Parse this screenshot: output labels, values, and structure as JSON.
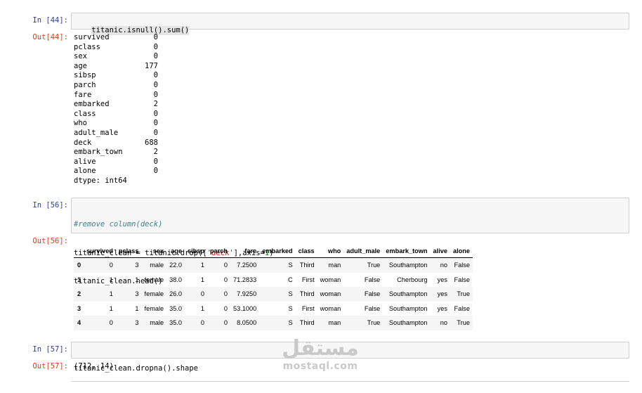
{
  "cells": [
    {
      "in_prompt": "In [44]:",
      "code": "titanic.isnull().sum()",
      "out_prompt": "Out[44]:",
      "series": [
        {
          "k": "survived",
          "v": "0"
        },
        {
          "k": "pclass",
          "v": "0"
        },
        {
          "k": "sex",
          "v": "0"
        },
        {
          "k": "age",
          "v": "177"
        },
        {
          "k": "sibsp",
          "v": "0"
        },
        {
          "k": "parch",
          "v": "0"
        },
        {
          "k": "fare",
          "v": "0"
        },
        {
          "k": "embarked",
          "v": "2"
        },
        {
          "k": "class",
          "v": "0"
        },
        {
          "k": "who",
          "v": "0"
        },
        {
          "k": "adult_male",
          "v": "0"
        },
        {
          "k": "deck",
          "v": "688"
        },
        {
          "k": "embark_town",
          "v": "2"
        },
        {
          "k": "alive",
          "v": "0"
        },
        {
          "k": "alone",
          "v": "0"
        }
      ],
      "dtype": "dtype: int64"
    },
    {
      "in_prompt": "In [56]:",
      "code_comment": "#remove column(deck)",
      "code_line2_a": "titanic_clean = titanic.drop([",
      "code_line2_str": "'deck'",
      "code_line2_b": "],axis=",
      "code_line2_num": "1",
      "code_line2_c": ")",
      "code_line3": "titanic_clean.head()",
      "out_prompt": "Out[56]:",
      "table": {
        "columns": [
          "",
          "survived",
          "pclass",
          "sex",
          "age",
          "sibsp",
          "parch",
          "fare",
          "embarked",
          "class",
          "who",
          "adult_male",
          "embark_town",
          "alive",
          "alone"
        ],
        "rows": [
          [
            "0",
            "0",
            "3",
            "male",
            "22.0",
            "1",
            "0",
            "7.2500",
            "S",
            "Third",
            "man",
            "True",
            "Southampton",
            "no",
            "False"
          ],
          [
            "1",
            "1",
            "1",
            "female",
            "38.0",
            "1",
            "0",
            "71.2833",
            "C",
            "First",
            "woman",
            "False",
            "Cherbourg",
            "yes",
            "False"
          ],
          [
            "2",
            "1",
            "3",
            "female",
            "26.0",
            "0",
            "0",
            "7.9250",
            "S",
            "Third",
            "woman",
            "False",
            "Southampton",
            "yes",
            "True"
          ],
          [
            "3",
            "1",
            "1",
            "female",
            "35.0",
            "1",
            "0",
            "53.1000",
            "S",
            "First",
            "woman",
            "False",
            "Southampton",
            "yes",
            "False"
          ],
          [
            "4",
            "0",
            "3",
            "male",
            "35.0",
            "0",
            "0",
            "8.0500",
            "S",
            "Third",
            "man",
            "True",
            "Southampton",
            "no",
            "True"
          ]
        ]
      }
    },
    {
      "in_prompt": "In [57]:",
      "code": "titanic_clean.dropna().shape",
      "out_prompt": "Out[57]:",
      "output": "(712, 14)"
    }
  ],
  "watermark": {
    "arabic": "مستقل",
    "latin": "mostaql.com"
  }
}
